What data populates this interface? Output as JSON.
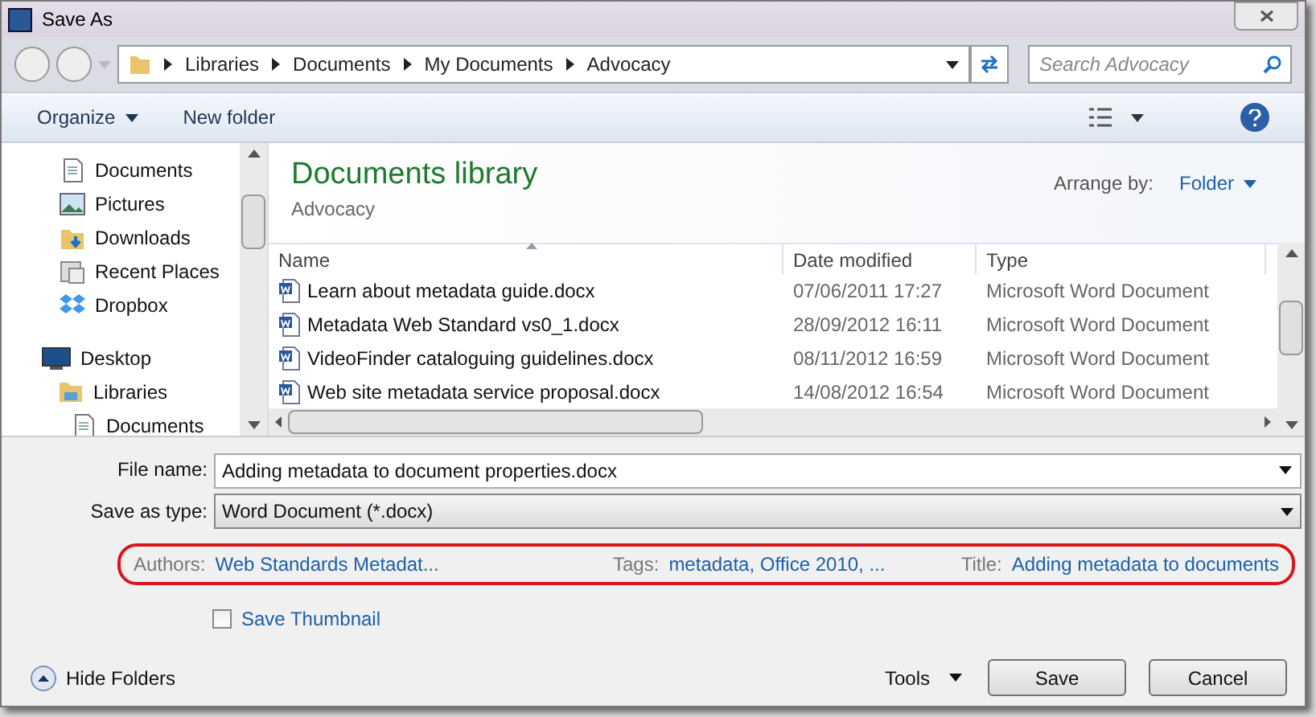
{
  "window": {
    "title": "Save As"
  },
  "address_bar": {
    "crumbs": [
      "Libraries",
      "Documents",
      "My Documents",
      "Advocacy"
    ]
  },
  "search": {
    "placeholder": "Search Advocacy"
  },
  "toolbar": {
    "organize": "Organize",
    "new_folder": "New folder"
  },
  "sidebar": {
    "items": [
      {
        "label": "Documents"
      },
      {
        "label": "Pictures"
      },
      {
        "label": "Downloads"
      },
      {
        "label": "Recent Places"
      },
      {
        "label": "Dropbox"
      }
    ],
    "tree": [
      {
        "label": "Desktop",
        "children": [
          {
            "label": "Libraries",
            "children": [
              {
                "label": "Documents"
              }
            ]
          }
        ]
      }
    ]
  },
  "library": {
    "title": "Documents library",
    "subtitle": "Advocacy",
    "arrange_label": "Arrange by:",
    "arrange_value": "Folder"
  },
  "table": {
    "columns": [
      {
        "label": "Name",
        "sorted": true
      },
      {
        "label": "Date modified",
        "sorted": false
      },
      {
        "label": "Type",
        "sorted": false
      }
    ],
    "rows": [
      [
        "Learn about metadata guide.docx",
        "07/06/2011 17:27",
        "Microsoft Word Document"
      ],
      [
        "Metadata Web Standard vs0_1.docx",
        "28/09/2012 16:11",
        "Microsoft Word Document"
      ],
      [
        "VideoFinder cataloguing guidelines.docx",
        "08/11/2012 16:59",
        "Microsoft Word Document"
      ],
      [
        "Web site metadata service proposal.docx",
        "14/08/2012 16:54",
        "Microsoft Word Document"
      ]
    ]
  },
  "file_name": {
    "label": "File name:",
    "value": "Adding metadata to document properties.docx"
  },
  "save_type": {
    "label": "Save as type:",
    "value": "Word Document (*.docx)"
  },
  "metadata": [
    {
      "label": "Authors:",
      "value": "Web Standards Metadat..."
    },
    {
      "label": "Tags:",
      "value": "metadata, Office 2010, ..."
    },
    {
      "label": "Title:",
      "value": "Adding metadata to documents"
    }
  ],
  "save_thumbnail": {
    "label": "Save Thumbnail",
    "checked": false
  },
  "footer": {
    "hide_folders": "Hide Folders",
    "tools": "Tools",
    "buttons": [
      "Save",
      "Cancel"
    ]
  }
}
